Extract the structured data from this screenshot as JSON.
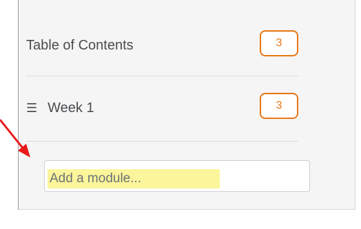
{
  "toc": {
    "label": "Table of Contents",
    "count": "3"
  },
  "modules": [
    {
      "drag_icon": "☰",
      "label": "Week 1",
      "count": "3"
    }
  ],
  "add_module": {
    "placeholder": "Add a module..."
  },
  "colors": {
    "accent": "#e87511",
    "highlight": "#fbf59b",
    "annotation_arrow": "#e8191b"
  }
}
